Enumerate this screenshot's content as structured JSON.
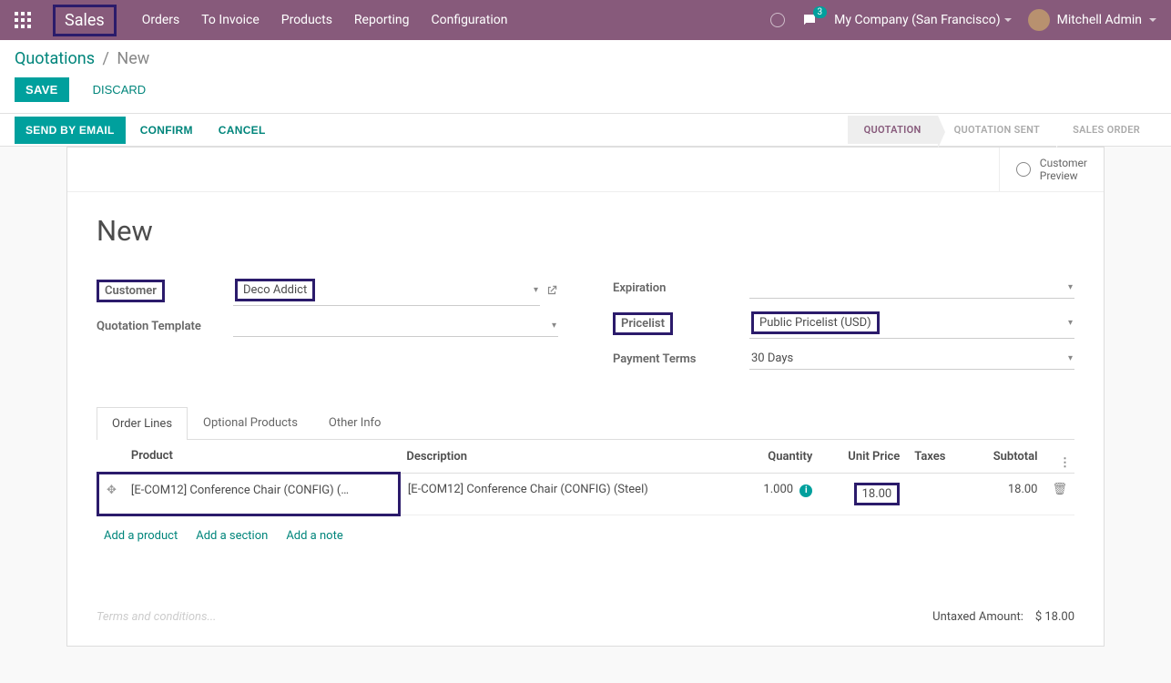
{
  "topbar": {
    "brand": "Sales",
    "nav": [
      "Orders",
      "To Invoice",
      "Products",
      "Reporting",
      "Configuration"
    ],
    "chat_badge": "3",
    "company": "My Company (San Francisco)",
    "user": "Mitchell Admin"
  },
  "breadcrumb": {
    "root": "Quotations",
    "current": "New"
  },
  "actions": {
    "save": "SAVE",
    "discard": "DISCARD"
  },
  "statusbar": {
    "buttons": {
      "email": "SEND BY EMAIL",
      "confirm": "CONFIRM",
      "cancel": "CANCEL"
    },
    "stages": [
      "QUOTATION",
      "QUOTATION SENT",
      "SALES ORDER"
    ]
  },
  "preview": {
    "line1": "Customer",
    "line2": "Preview"
  },
  "title": "New",
  "fields": {
    "customer_label": "Customer",
    "customer_value": "Deco Addict",
    "template_label": "Quotation Template",
    "template_value": "",
    "expiration_label": "Expiration",
    "expiration_value": "",
    "pricelist_label": "Pricelist",
    "pricelist_value": "Public Pricelist (USD)",
    "terms_label": "Payment Terms",
    "terms_value": "30 Days"
  },
  "tabs": [
    "Order Lines",
    "Optional Products",
    "Other Info"
  ],
  "table": {
    "headers": {
      "product": "Product",
      "description": "Description",
      "quantity": "Quantity",
      "unit_price": "Unit Price",
      "taxes": "Taxes",
      "subtotal": "Subtotal"
    },
    "row": {
      "product": "[E-COM12] Conference Chair (CONFIG) (…",
      "description": "[E-COM12] Conference Chair (CONFIG) (Steel)",
      "quantity": "1.000",
      "unit_price": "18.00",
      "taxes": "",
      "subtotal": "18.00"
    },
    "add": {
      "product": "Add a product",
      "section": "Add a section",
      "note": "Add a note"
    }
  },
  "footer": {
    "terms_placeholder": "Terms and conditions...",
    "untaxed_label": "Untaxed Amount:",
    "untaxed_value": "$ 18.00"
  }
}
